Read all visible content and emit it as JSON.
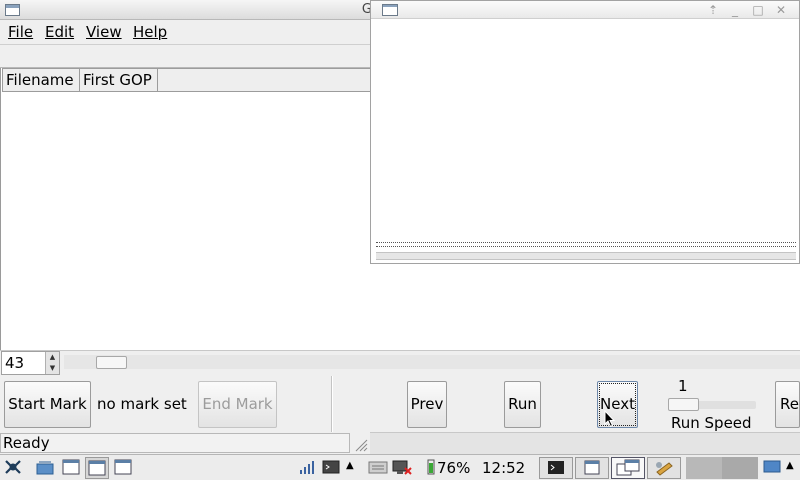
{
  "main_window": {
    "title_fragment": "G",
    "menu": [
      {
        "label": "File"
      },
      {
        "label": "Edit"
      },
      {
        "label": "View"
      },
      {
        "label": "Help"
      }
    ],
    "list_columns": [
      "Filename",
      "First GOP"
    ]
  },
  "controls": {
    "frame_spinner_value": "43",
    "start_mark_label": "Start Mark",
    "mark_status": "no mark set",
    "end_mark_label": "End Mark",
    "prev_label": "Prev",
    "run_label": "Run",
    "next_label": "Next",
    "refresh_label_visible": "Ref",
    "run_speed_value": "1",
    "run_speed_label": "Run Speed"
  },
  "status": {
    "text": "Ready"
  },
  "taskbar": {
    "battery": "76%",
    "clock": "12:52"
  },
  "colors": {
    "accent": "#8aa2bd",
    "window_bg": "#efefef",
    "battery_green": "#3aa836"
  }
}
